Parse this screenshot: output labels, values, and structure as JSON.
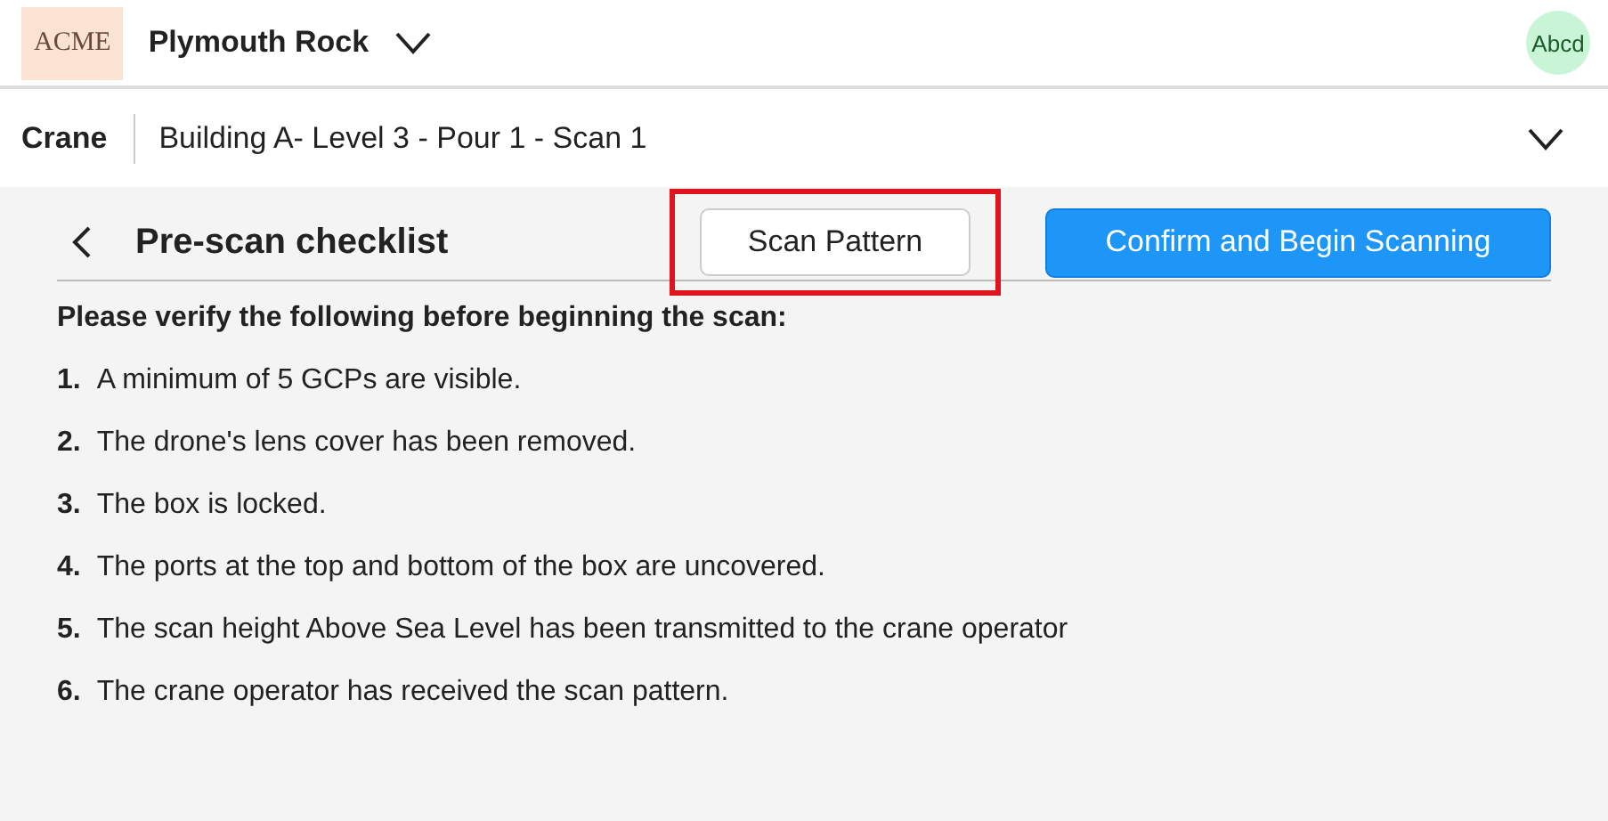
{
  "header": {
    "logo": "ACME",
    "project": "Plymouth Rock",
    "avatar": "Abcd"
  },
  "subheader": {
    "device": "Crane",
    "scan": "Building A- Level 3 - Pour 1 - Scan 1"
  },
  "page": {
    "title": "Pre-scan checklist",
    "secondary_button": {
      "label": "Scan Pattern",
      "highlighted": true
    },
    "primary_button": "Confirm and Begin Scanning"
  },
  "intro": "Please verify the following before beginning the scan:",
  "items": [
    {
      "number": "1.",
      "text": "A minimum of 5 GCPs are visible."
    },
    {
      "number": "2.",
      "text": "The drone's lens cover has been removed."
    },
    {
      "number": "3.",
      "text": "The box is locked."
    },
    {
      "number": "4.",
      "text": "The ports at the top and bottom of the box are uncovered."
    },
    {
      "number": "5.",
      "text": "The scan height Above Sea Level has been transmitted to the crane operator"
    },
    {
      "number": "6.",
      "text": "The crane operator has received the scan pattern."
    }
  ]
}
